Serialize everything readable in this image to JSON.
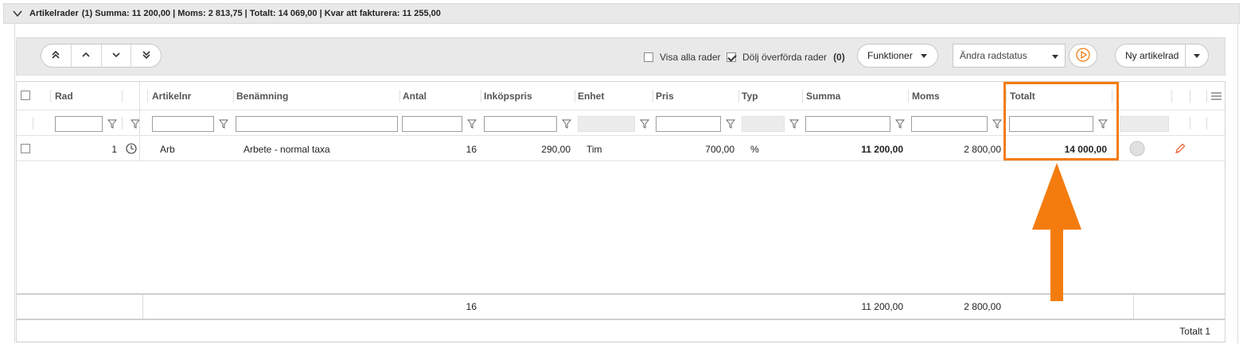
{
  "header": {
    "title": "Artikelrader",
    "summary": "(1) Summa: 11 200,00 | Moms: 2 813,75 | Totalt: 14 069,00 | Kvar att fakturera: 11 255,00"
  },
  "toolbar": {
    "show_all_rows_label": "Visa alla rader",
    "hide_transferred_label": "Dölj överförda rader",
    "hidden_count": "(0)",
    "functions_label": "Funktioner",
    "row_status_placeholder": "Ändra radstatus",
    "new_row_label": "Ny artikelrad"
  },
  "columns": {
    "rad": "Rad",
    "artikelnr": "Artikelnr",
    "benamning": "Benämning",
    "antal": "Antal",
    "inkopspris": "Inköpspris",
    "enhet": "Enhet",
    "pris": "Pris",
    "typ": "Typ",
    "summa": "Summa",
    "moms": "Moms",
    "totalt": "Totalt"
  },
  "rows": [
    {
      "rad": "1",
      "artikelnr": "Arb",
      "benamning": "Arbete - normal taxa",
      "antal": "16",
      "inkopspris": "290,00",
      "enhet": "Tim",
      "pris": "700,00",
      "typ": "%",
      "summa": "11 200,00",
      "moms": "2 800,00",
      "totalt": "14 000,00"
    }
  ],
  "footer": {
    "antal": "16",
    "summa": "11 200,00",
    "moms": "2 800,00",
    "total_count": "Totalt 1"
  },
  "icons": {
    "collapse": "chevron-down-icon",
    "first": "double-chevron-up-icon",
    "up": "chevron-up-icon",
    "down": "chevron-down-icon",
    "last": "double-chevron-down-icon",
    "filter": "filter-icon",
    "history": "clock-icon",
    "status": "circle-status-icon",
    "edit": "pencil-icon",
    "menu": "hamburger-menu-icon",
    "play": "play-circle-icon"
  },
  "colors": {
    "accent": "#f47c0f",
    "header_bg": "#e9e9e9"
  }
}
